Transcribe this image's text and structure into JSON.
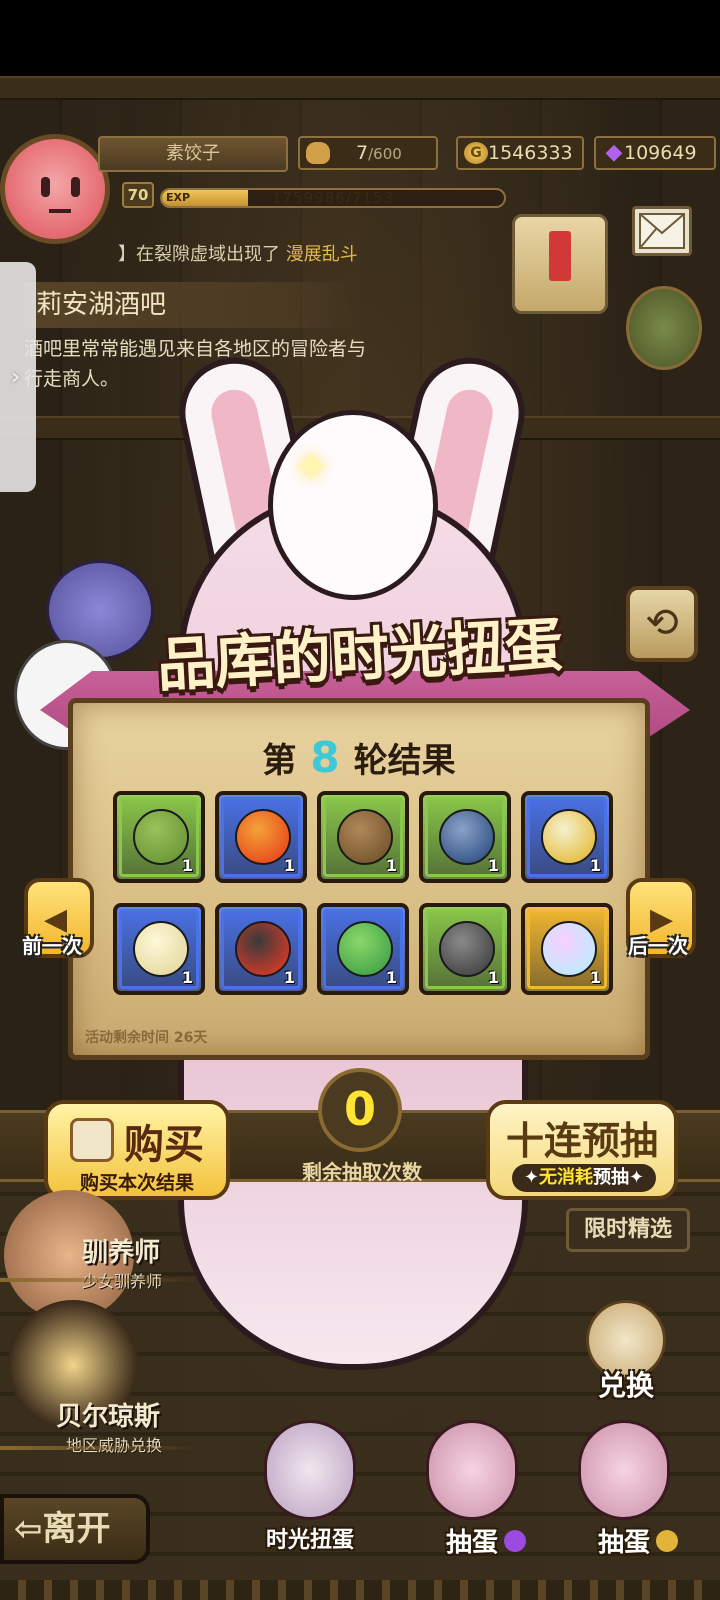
{
  "player": {
    "name": "素饺子",
    "level": "70",
    "exp_label": "EXP",
    "exp_text": "1759986/7153",
    "exp_fraction": 0.25
  },
  "resources": {
    "stamina_current": "7",
    "stamina_max": "/600",
    "gold": "1546333",
    "gems": "109649"
  },
  "news": {
    "prefix": "】在裂隙虚域出现了",
    "highlight": "漫展乱斗"
  },
  "location": {
    "title": "莉安湖酒吧",
    "description": "酒吧里常常能遇见来自各地区的冒险者与行走商人。"
  },
  "banner": {
    "title": "品库的时光扭蛋"
  },
  "results": {
    "round_prefix": "第",
    "round_number": "8",
    "round_suffix": "轮结果",
    "event_time": "活动剩余时间 26天",
    "items": [
      {
        "name": "sprout-seed",
        "count": "1",
        "rarity": "green",
        "colors": [
          "#6e9a3a",
          "#9ac25a"
        ]
      },
      {
        "name": "fire-swirl",
        "count": "1",
        "rarity": "blue",
        "colors": [
          "#e8501e",
          "#f5a23a"
        ]
      },
      {
        "name": "wooden-egg",
        "count": "1",
        "rarity": "green",
        "colors": [
          "#7a5a30",
          "#b0885a"
        ]
      },
      {
        "name": "blue-shell",
        "count": "1",
        "rarity": "green",
        "colors": [
          "#3a5a8a",
          "#8aa2c8"
        ]
      },
      {
        "name": "gold-jellyfish",
        "count": "1",
        "rarity": "blue",
        "colors": [
          "#e6c24a",
          "#f5f0d0"
        ]
      },
      {
        "name": "lotus-bud",
        "count": "1",
        "rarity": "blue",
        "colors": [
          "#e6dca6",
          "#fff8d8"
        ]
      },
      {
        "name": "red-cat-hat",
        "count": "1",
        "rarity": "blue",
        "colors": [
          "#c83a2a",
          "#3a3a3a"
        ]
      },
      {
        "name": "cactus-bush",
        "count": "1",
        "rarity": "blue",
        "colors": [
          "#4aa84a",
          "#8ad86a"
        ]
      },
      {
        "name": "stone-golem",
        "count": "1",
        "rarity": "green",
        "colors": [
          "#4a4a4a",
          "#8a8a8a"
        ]
      },
      {
        "name": "winged-rainbow-egg",
        "count": "1",
        "rarity": "gold",
        "colors": [
          "#c2e8ff",
          "#f8d0ff"
        ]
      }
    ]
  },
  "rarity_colors": {
    "green": "#8ac84a",
    "blue": "#4a72e8",
    "gold": "#f2b830"
  },
  "nav": {
    "prev_label": "前一次",
    "next_label": "后一次"
  },
  "actions": {
    "buy_label": "购买",
    "buy_sub": "购买本次结果",
    "remaining_count": "0",
    "remaining_label": "剩余抽取次数",
    "ten_label": "十连预抽",
    "ten_sub_highlight": "无消耗",
    "ten_sub_rest": "预抽"
  },
  "npcs": [
    {
      "name": "驯养师",
      "subtitle": "少女驯养师"
    },
    {
      "name": "贝尔琼斯",
      "subtitle": "地区威胁兑换"
    }
  ],
  "side_buttons": {
    "limited": "限时精选",
    "exchange": "兑换"
  },
  "bottom_bar": {
    "leave": "离开",
    "time_gacha": "时光扭蛋",
    "draw_gem": "抽蛋",
    "draw_gold": "抽蛋"
  }
}
